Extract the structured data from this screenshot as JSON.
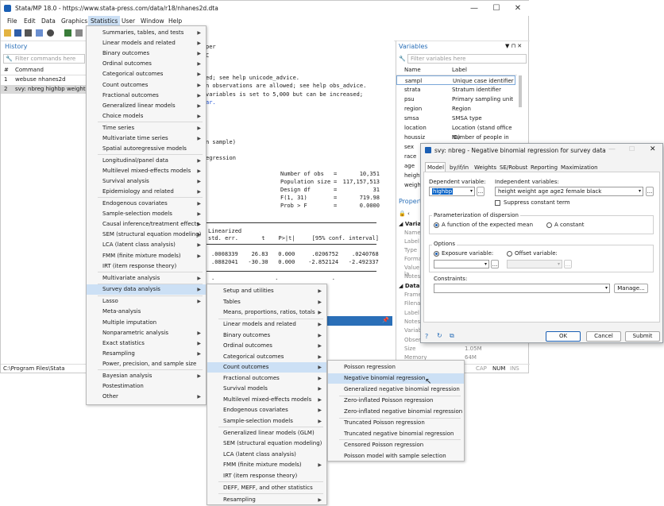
{
  "window": {
    "title": "Stata/MP 18.0 - https://www.stata-press.com/data/r18/nhanes2d.dta",
    "minimize": "—",
    "maximize": "☐",
    "close": "✕"
  },
  "menubar": [
    "File",
    "Edit",
    "Data",
    "Graphics",
    "Statistics",
    "User",
    "Window",
    "Help"
  ],
  "history": {
    "title": "History",
    "filter_placeholder": "Filter commands here",
    "col_num": "#",
    "col_cmd": "Command",
    "rows": [
      {
        "n": "1",
        "cmd": "webuse nhanes2d"
      },
      {
        "n": "2",
        "cmd": "svy: nbreg highbp weight"
      }
    ]
  },
  "results": {
    "lines": [
      "per",
      "C",
      "ed; see help unicode_advice.",
      "n observations are allowed; see help obs_advice.",
      "variables is set to 5,000 but can be increased;",
      "ar."
    ],
    "sample": "n sample)",
    "regression": "egression",
    "stats": [
      {
        "label": "Number of obs",
        "eq": "=",
        "val": "10,351"
      },
      {
        "label": "Population size",
        "eq": "=",
        "val": "117,157,513"
      },
      {
        "label": "Design df",
        "eq": "=",
        "val": "31"
      },
      {
        "label": "F(1, 31)",
        "eq": "=",
        "val": "719.98"
      },
      {
        "label": "Prob > F",
        "eq": "=",
        "val": "0.0000"
      }
    ],
    "linearized": "Linearized",
    "header_cols": "std. err.       t    P>|t|     [95% conf. interval]",
    "row1": ".0008339    26.83   0.000     .0206752    .0240768",
    "row2": ".0882041   -30.30   0.000    -2.852124   -2.492337",
    "row_dots": ".                  .                .",
    "row_dots2": ".             .",
    "command_pin": "📌"
  },
  "statusbar": {
    "path": "C:\\Program Files\\Stata",
    "caps": "CAP",
    "num": "NUM",
    "ins": "INS"
  },
  "variables": {
    "title": "Variables",
    "filter_placeholder": "Filter variables here",
    "col_name": "Name",
    "col_label": "Label",
    "rows": [
      {
        "name": "sampl",
        "label": "Unique case identifier"
      },
      {
        "name": "strata",
        "label": "Stratum identifier"
      },
      {
        "name": "psu",
        "label": "Primary sampling unit"
      },
      {
        "name": "region",
        "label": "Region"
      },
      {
        "name": "smsa",
        "label": "SMSA type"
      },
      {
        "name": "location",
        "label": "Location (stand office ID)"
      },
      {
        "name": "houssiz",
        "label": "Number of people in ho..."
      },
      {
        "name": "sex",
        "label": ""
      },
      {
        "name": "race",
        "label": ""
      },
      {
        "name": "age",
        "label": ""
      },
      {
        "name": "height",
        "label": ""
      },
      {
        "name": "weight",
        "label": ""
      }
    ]
  },
  "properties": {
    "title": "Properti",
    "variables_hdr": "Variabl",
    "var_fields": [
      "Name",
      "Label",
      "Type",
      "Format",
      "Value la",
      "Notes"
    ],
    "data_hdr": "Data",
    "data_fields": [
      "Frame",
      "Filenam",
      "Label",
      "Notes",
      "Variable",
      "Observ",
      "Size",
      "Memory"
    ],
    "size_val": "1.05M",
    "memory_val": "64M"
  },
  "statistics_menu": {
    "items": [
      {
        "label": "Summaries, tables, and tests",
        "arrow": true
      },
      {
        "label": "Linear models and related",
        "arrow": true
      },
      {
        "label": "Binary outcomes",
        "arrow": true
      },
      {
        "label": "Ordinal outcomes",
        "arrow": true
      },
      {
        "label": "Categorical outcomes",
        "arrow": true
      },
      {
        "label": "Count outcomes",
        "arrow": true
      },
      {
        "label": "Fractional outcomes",
        "arrow": true
      },
      {
        "label": "Generalized linear models",
        "arrow": true
      },
      {
        "label": "Choice models",
        "arrow": true
      },
      {
        "label": "Time series",
        "arrow": true
      },
      {
        "label": "Multivariate time series",
        "arrow": true
      },
      {
        "label": "Spatial autoregressive models",
        "arrow": false
      },
      {
        "label": "Longitudinal/panel data",
        "arrow": true
      },
      {
        "label": "Multilevel mixed-effects models",
        "arrow": true
      },
      {
        "label": "Survival analysis",
        "arrow": true
      },
      {
        "label": "Epidemiology and related",
        "arrow": true
      },
      {
        "label": "Endogenous covariates",
        "arrow": true
      },
      {
        "label": "Sample-selection models",
        "arrow": true
      },
      {
        "label": "Causal inference/treatment effects",
        "arrow": true
      },
      {
        "label": "SEM (structural equation modeling)",
        "arrow": true
      },
      {
        "label": "LCA (latent class analysis)",
        "arrow": true
      },
      {
        "label": "FMM (finite mixture models)",
        "arrow": true
      },
      {
        "label": "IRT (item response theory)",
        "arrow": false
      },
      {
        "label": "Multivariate analysis",
        "arrow": true
      },
      {
        "label": "Survey data analysis",
        "arrow": true
      },
      {
        "label": "Lasso",
        "arrow": true
      },
      {
        "label": "Meta-analysis",
        "arrow": false
      },
      {
        "label": "Multiple imputation",
        "arrow": false
      },
      {
        "label": "Nonparametric analysis",
        "arrow": true
      },
      {
        "label": "Exact statistics",
        "arrow": true
      },
      {
        "label": "Resampling",
        "arrow": true
      },
      {
        "label": "Power, precision, and sample size",
        "arrow": false
      },
      {
        "label": "Bayesian analysis",
        "arrow": true
      },
      {
        "label": "Postestimation",
        "arrow": false
      },
      {
        "label": "Other",
        "arrow": true
      }
    ]
  },
  "survey_menu": {
    "items": [
      {
        "label": "Setup and utilities",
        "arrow": true
      },
      {
        "label": "Tables",
        "arrow": true
      },
      {
        "label": "Means, proportions, ratios, totals",
        "arrow": true
      },
      {
        "label": "Linear models and related",
        "arrow": true
      },
      {
        "label": "Binary outcomes",
        "arrow": true
      },
      {
        "label": "Ordinal outcomes",
        "arrow": true
      },
      {
        "label": "Categorical outcomes",
        "arrow": true
      },
      {
        "label": "Count outcomes",
        "arrow": true
      },
      {
        "label": "Fractional outcomes",
        "arrow": true
      },
      {
        "label": "Survival models",
        "arrow": true
      },
      {
        "label": "Multilevel mixed-effects models",
        "arrow": true
      },
      {
        "label": "Endogenous covariates",
        "arrow": true
      },
      {
        "label": "Sample-selection models",
        "arrow": true
      },
      {
        "label": "Generalized linear models (GLM)",
        "arrow": false
      },
      {
        "label": "SEM (structural equation modeling)",
        "arrow": false
      },
      {
        "label": "LCA (latent class analysis)",
        "arrow": false
      },
      {
        "label": "FMM (finite mixture models)",
        "arrow": true
      },
      {
        "label": "IRT (item response theory)",
        "arrow": false
      },
      {
        "label": "DEFF, MEFF, and other statistics",
        "arrow": false
      },
      {
        "label": "Resampling",
        "arrow": true
      }
    ]
  },
  "count_menu": {
    "items": [
      "Poisson regression",
      "Negative binomial regression",
      "Generalized negative binomial regression",
      "Zero-inflated Poisson regression",
      "Zero-inflated negative binomial regression",
      "Truncated Poisson regression",
      "Truncated negative binomial regression",
      "Censored Poisson regression",
      "Poisson model with sample selection"
    ]
  },
  "dialog": {
    "title": "svy: nbreg - Negative binomial regression for survey data",
    "tabs": [
      "Model",
      "by/if/in",
      "Weights",
      "SE/Robust",
      "Reporting",
      "Maximization"
    ],
    "dep_label": "Dependent variable:",
    "dep_value": "highbp",
    "indep_label": "Independent variables:",
    "indep_value": "height weight age age2 female black",
    "suppress": "Suppress constant term",
    "param_title": "Parameterization of dispersion",
    "param_opt1": "A function of the expected mean",
    "param_opt2": "A constant",
    "options_title": "Options",
    "exposure": "Exposure variable:",
    "offset": "Offset variable:",
    "constraints": "Constraints:",
    "manage": "Manage...",
    "ok": "OK",
    "cancel": "Cancel",
    "submit": "Submit",
    "browse": "..."
  },
  "colors": {
    "accent": "#2a6fb8",
    "highlight": "#cce0f5",
    "selection": "#0a64c8",
    "link": "#1a4fd6"
  }
}
